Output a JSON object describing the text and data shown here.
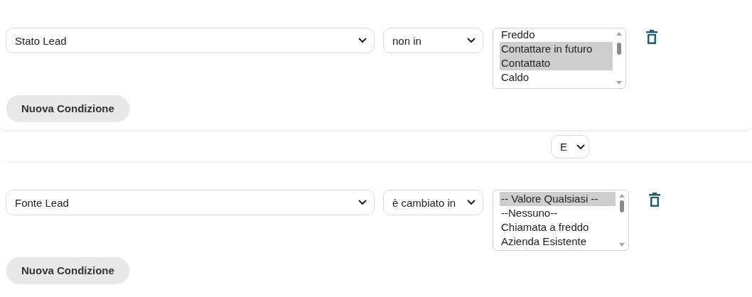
{
  "conditions": [
    {
      "field": {
        "value": "Stato Lead"
      },
      "operator": {
        "value": "non in"
      },
      "options": [
        {
          "label": "Freddo",
          "selected": false
        },
        {
          "label": "Contattare in futuro",
          "selected": true
        },
        {
          "label": "Contattato",
          "selected": true
        },
        {
          "label": "Caldo",
          "selected": false
        }
      ],
      "add_button": "Nuova Condizione"
    },
    {
      "field": {
        "value": "Fonte Lead"
      },
      "operator": {
        "value": "è cambiato in"
      },
      "options": [
        {
          "label": "-- Valore Qualsiasi --",
          "selected": true
        },
        {
          "label": "--Nessuno--",
          "selected": false
        },
        {
          "label": "Chiamata a freddo",
          "selected": false
        },
        {
          "label": "Azienda Esistente",
          "selected": false
        }
      ],
      "add_button": "Nuova Condizione"
    }
  ],
  "join": {
    "value": "E"
  }
}
